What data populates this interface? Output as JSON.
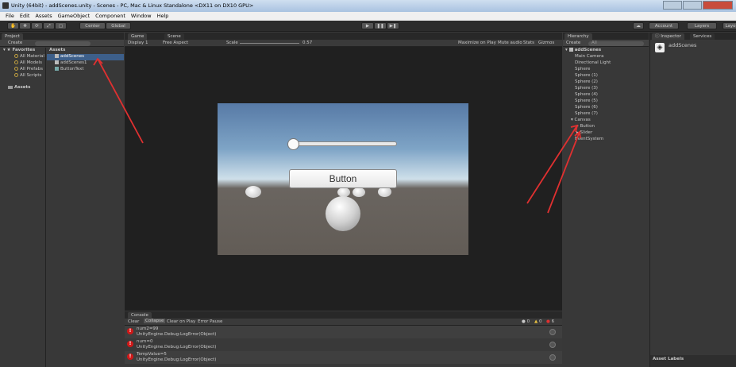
{
  "window": {
    "title": "Unity (64bit) - addScenes.unity - Scenes - PC, Mac & Linux Standalone <DX11 on DX10 GPU>"
  },
  "menu": [
    "File",
    "Edit",
    "Assets",
    "GameObject",
    "Component",
    "Window",
    "Help"
  ],
  "toolbar": {
    "pivot_label": "Center",
    "space_label": "Global",
    "account_label": "Account",
    "layers_label": "Layers",
    "layout_label": "Layo"
  },
  "project": {
    "tab": "Project",
    "create_label": "Create",
    "favorites_label": "Favorites",
    "favorites": [
      "All Material",
      "All Models",
      "All Prefabs",
      "All Scripts"
    ],
    "assets_label": "Assets",
    "assets_header": "Assets",
    "files": [
      "addScenes",
      "addScenes1",
      "ButtonText"
    ]
  },
  "game": {
    "tab_game": "Game",
    "tab_scene": "Scene",
    "display": "Display 1",
    "aspect": "Free Aspect",
    "scale_label": "Scale",
    "scale_value": "0.57",
    "toggles": [
      "Maximize on Play",
      "Mute audio",
      "Stats",
      "Gizmos"
    ],
    "button_text": "Button",
    "slider_value": 0
  },
  "hierarchy": {
    "tab": "Hierarchy",
    "create_label": "Create",
    "search_placeholder": "All",
    "scene": "addScenes",
    "items": [
      "Main Camera",
      "Directional Light",
      "Sphere",
      "Sphere (1)",
      "Sphere (2)",
      "Sphere (3)",
      "Sphere (4)",
      "Sphere (5)",
      "Sphere (6)",
      "Sphere (7)"
    ],
    "canvas": "Canvas",
    "canvas_children": [
      "Button",
      "Slider"
    ],
    "eventsystem": "EventSystem"
  },
  "inspector": {
    "tab": "Inspector",
    "tab2": "Services",
    "title": "addScenes",
    "asset_labels": "Asset Labels"
  },
  "console": {
    "tab": "Console",
    "buttons": [
      "Clear",
      "Collapse",
      "Clear on Play",
      "Error Pause"
    ],
    "counts": {
      "log": "0",
      "warn": "0",
      "error": "6"
    },
    "entries": [
      {
        "line1": "num2=99",
        "line2": "UnityEngine.Debug:LogError(Object)"
      },
      {
        "line1": "num=0",
        "line2": "UnityEngine.Debug:LogError(Object)"
      },
      {
        "line1": "TempValue=5",
        "line2": "UnityEngine.Debug:LogError(Object)"
      }
    ]
  },
  "colors": {
    "accent_red": "#e03030",
    "selection": "#3d5f8a"
  }
}
